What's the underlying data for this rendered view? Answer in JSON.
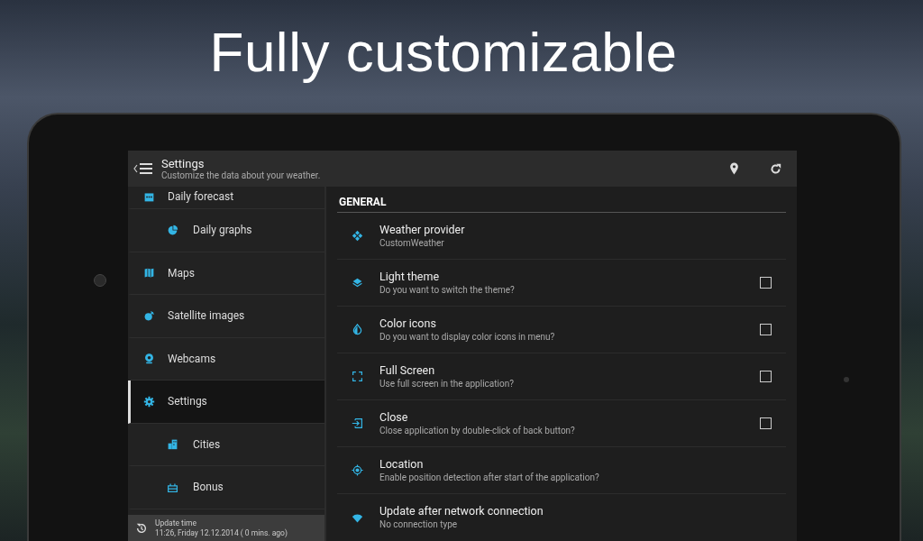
{
  "headline": "Fully customizable",
  "app_bar": {
    "title": "Settings",
    "subtitle": "Customize the data about your weather."
  },
  "sidebar": {
    "items": [
      {
        "label": "Daily forecast",
        "selected": false,
        "children": [
          {
            "label": "Daily graphs",
            "selected": false
          }
        ]
      },
      {
        "label": "Maps",
        "selected": false
      },
      {
        "label": "Satellite images",
        "selected": false
      },
      {
        "label": "Webcams",
        "selected": false
      },
      {
        "label": "Settings",
        "selected": true,
        "children": [
          {
            "label": "Cities",
            "selected": false
          },
          {
            "label": "Bonus",
            "selected": false
          }
        ]
      }
    ],
    "footer": {
      "title": "Update time",
      "value": "11:26, Friday 12.12.2014 ( 0 mins. ago)"
    }
  },
  "section": {
    "title": "GENERAL",
    "rows": [
      {
        "kind": "plain",
        "title": "Weather provider",
        "subtitle": "CustomWeather"
      },
      {
        "kind": "checkbox",
        "title": "Light theme",
        "subtitle": "Do you want to switch the theme?",
        "checked": false
      },
      {
        "kind": "checkbox",
        "title": "Color icons",
        "subtitle": "Do you want to display color icons in menu?",
        "checked": false
      },
      {
        "kind": "checkbox",
        "title": "Full Screen",
        "subtitle": "Use full screen in the application?",
        "checked": false
      },
      {
        "kind": "checkbox",
        "title": "Close",
        "subtitle": "Close application by double-click of back button?",
        "checked": false
      },
      {
        "kind": "plain",
        "title": "Location",
        "subtitle": "Enable position detection after start of the application?"
      },
      {
        "kind": "plain",
        "title": "Update after network connection",
        "subtitle": "No connection type"
      }
    ]
  }
}
